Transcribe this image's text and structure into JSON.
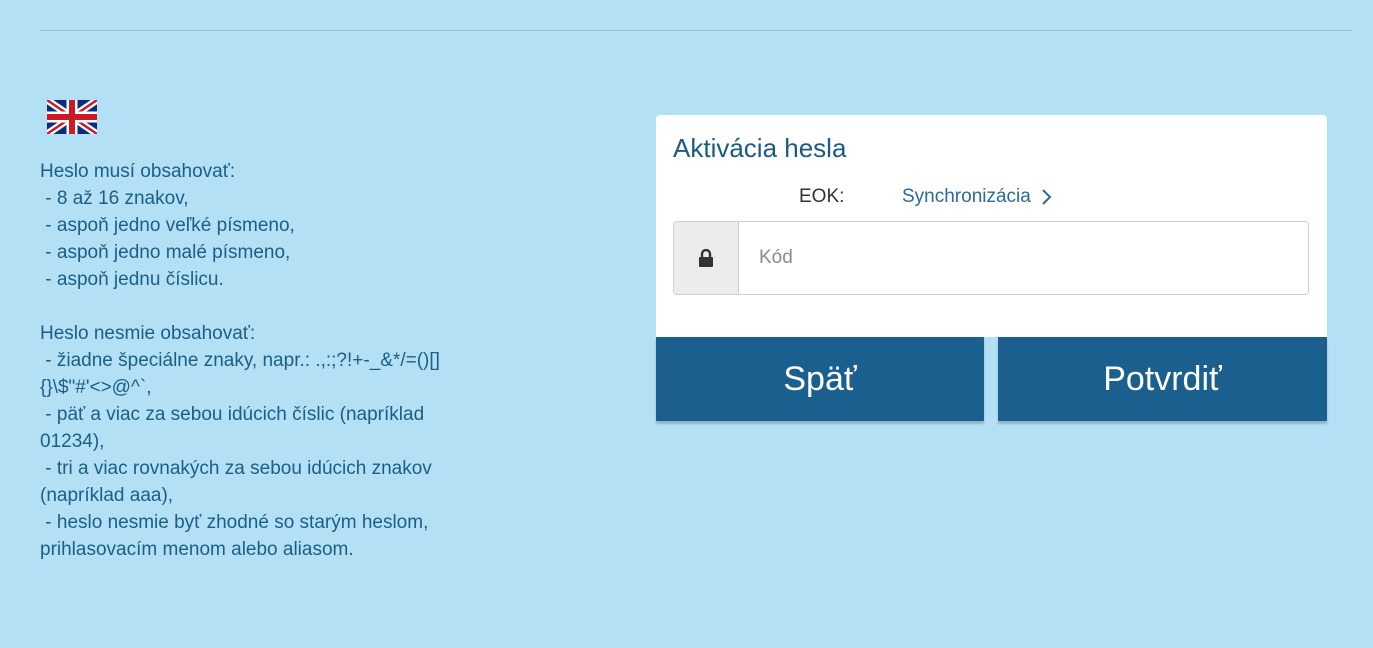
{
  "password_rules": {
    "must_heading": "Heslo musí obsahovať:",
    "must_items": [
      " - 8 až 16 znakov,",
      " - aspoň jedno veľké písmeno,",
      " - aspoň jedno malé písmeno,",
      " - aspoň jednu číslicu."
    ],
    "must_not_heading": "Heslo nesmie obsahovať:",
    "must_not_lines": [
      " - žiadne špeciálne znaky, napr.: .,:;?!+-_&*/=()[]",
      "{}\\$\"#'<>@^`,",
      " - päť a viac za sebou idúcich číslic (napríklad",
      "01234),",
      " - tri a viac rovnakých za sebou idúcich znakov",
      "(napríklad aaa),",
      " - heslo nesmie byť zhodné so starým heslom,",
      "prihlasovacím menom alebo aliasom."
    ]
  },
  "language": {
    "icon": "uk-flag-icon"
  },
  "card": {
    "title": "Aktivácia hesla",
    "eok_label": "EOK:",
    "sync_link": "Synchronizácia",
    "code_placeholder": "Kód",
    "code_value": ""
  },
  "buttons": {
    "back": "Späť",
    "confirm": "Potvrdiť"
  },
  "colors": {
    "background": "#b3e0f5",
    "text": "#1d5e86",
    "button": "#1a5f8d",
    "card": "#ffffff"
  }
}
